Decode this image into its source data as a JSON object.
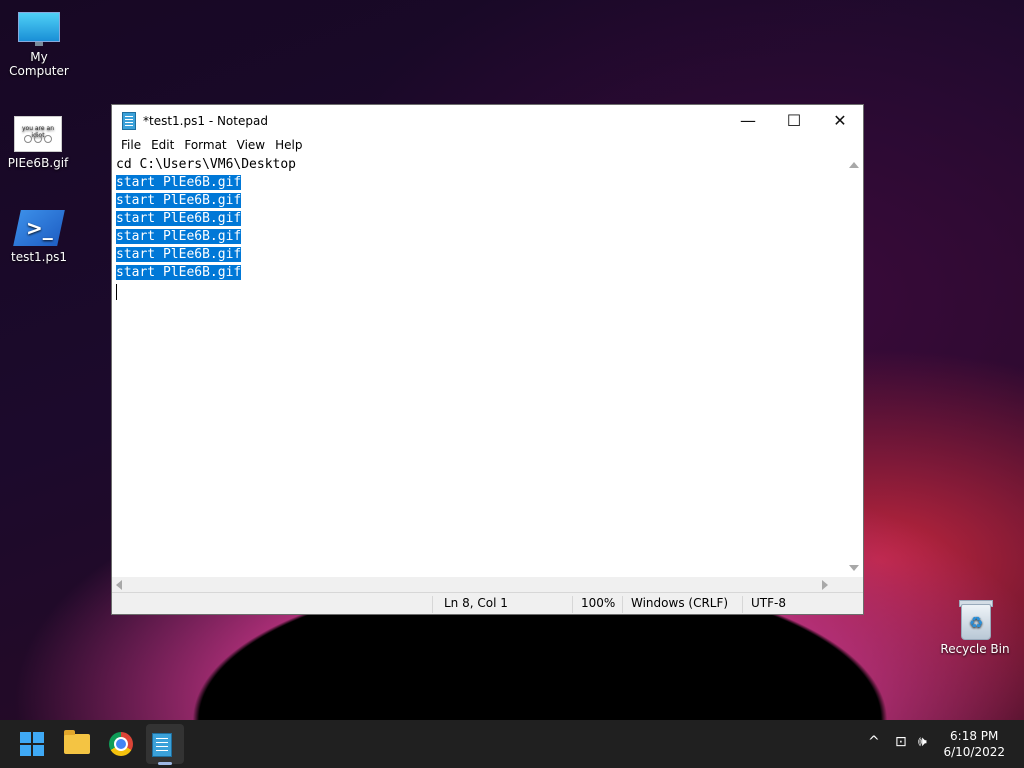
{
  "desktop": {
    "icons": [
      {
        "label": "My Computer",
        "icon": "monitor-icon"
      },
      {
        "label": "PIEe6B.gif",
        "icon": "gif-thumbnail-icon",
        "thumb_text": "you are an idiot"
      },
      {
        "label": "test1.ps1",
        "icon": "powershell-icon"
      },
      {
        "label": "Recycle Bin",
        "icon": "recycle-bin-icon"
      }
    ]
  },
  "notepad": {
    "title": "*test1.ps1 - Notepad",
    "window_buttons": {
      "minimize": "—",
      "maximize": "☐",
      "close": "✕"
    },
    "menu": [
      "File",
      "Edit",
      "Format",
      "View",
      "Help"
    ],
    "lines": [
      "cd C:\\Users\\VM6\\Desktop",
      "start PlEe6B.gif",
      "start PlEe6B.gif",
      "start PlEe6B.gif",
      "start PlEe6B.gif",
      "start PlEe6B.gif",
      "start PlEe6B.gif"
    ],
    "selected_lines": [
      1,
      2,
      3,
      4,
      5,
      6
    ],
    "status": {
      "position": "Ln 8, Col 1",
      "zoom": "100%",
      "line_ending": "Windows (CRLF)",
      "encoding": "UTF-8"
    }
  },
  "taskbar": {
    "apps": [
      "start-icon",
      "file-explorer-icon",
      "chrome-icon",
      "notepad-icon"
    ],
    "active_app": "notepad-icon",
    "tray": {
      "chevron": "^",
      "network": "⊡",
      "volume": "🕪"
    },
    "clock": {
      "time": "6:18 PM",
      "date": "6/10/2022"
    }
  },
  "colors": {
    "selection": "#0078d7",
    "accent": "#3fa9f5"
  }
}
